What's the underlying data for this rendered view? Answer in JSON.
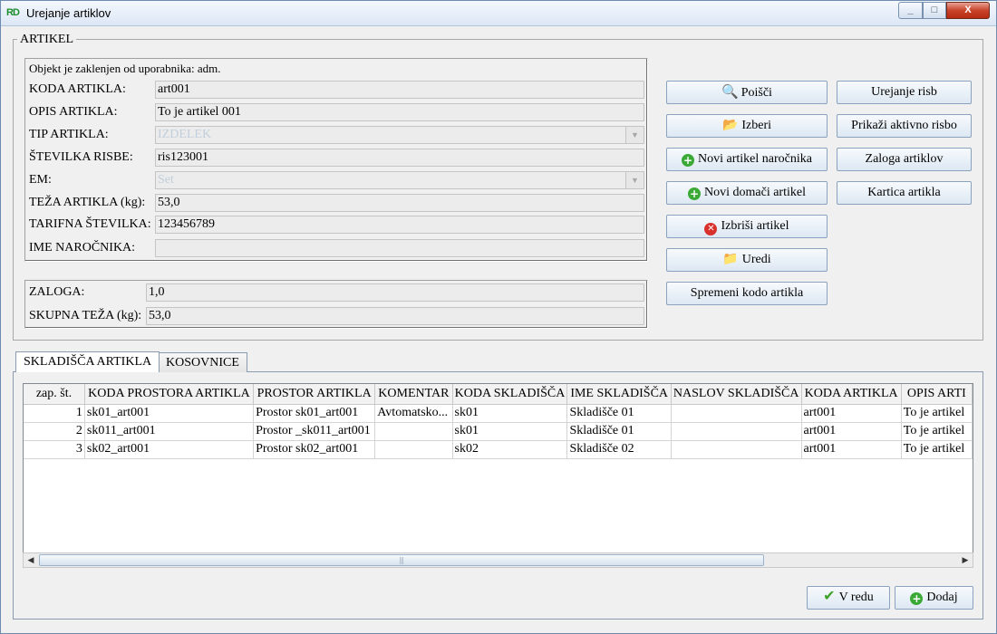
{
  "window": {
    "title": "Urejanje artiklov",
    "icon_text": "RD",
    "controls": {
      "minimize": "_",
      "maximize": "□",
      "close": "X"
    }
  },
  "group": {
    "legend": "ARTIKEL",
    "lock_message": "Objekt je zaklenjen od uporabnika: adm."
  },
  "fields": {
    "koda": {
      "label": "KODA ARTIKLA:",
      "value": "art001"
    },
    "opis": {
      "label": "OPIS ARTIKLA:",
      "value": "To je artikel 001"
    },
    "tip": {
      "label": "TIP ARTIKLA:",
      "value": "IZDELEK"
    },
    "risba": {
      "label": "ŠTEVILKA RISBE:",
      "value": "ris123001"
    },
    "em": {
      "label": "EM:",
      "value": "Set"
    },
    "teza": {
      "label": "TEŽA ARTIKLA (kg):",
      "value": "53,0"
    },
    "tarifna": {
      "label": "TARIFNA ŠTEVILKA:",
      "value": "123456789"
    },
    "narocnik": {
      "label": "IME NAROČNIKA:",
      "value": ""
    },
    "zaloga": {
      "label": "ZALOGA:",
      "value": "1,0"
    },
    "skupna": {
      "label": "SKUPNA TEŽA (kg):",
      "value": "53,0"
    }
  },
  "buttons": {
    "poisci": "Poišči",
    "izberi": "Izberi",
    "novi_narocnik": "Novi artikel naročnika",
    "novi_domaci": "Novi domači artikel",
    "izbrisi": "Izbriši artikel",
    "uredi": "Uredi",
    "spremeni_kodo": "Spremeni kodo artikla",
    "urejanje_risb": "Urejanje risb",
    "prikazi_risbo": "Prikaži aktivno risbo",
    "zaloga_artiklov": "Zaloga artiklov",
    "kartica": "Kartica artikla",
    "v_redu": "V redu",
    "dodaj": "Dodaj"
  },
  "tabs": [
    {
      "label": "SKLADIŠČA ARTIKLA"
    },
    {
      "label": "KOSOVNICE"
    }
  ],
  "table": {
    "columns": [
      "zap. št.",
      "KODA PROSTORA ARTIKLA",
      "PROSTOR ARTIKLA",
      "KOMENTAR",
      "KODA SKLADIŠČA",
      "IME SKLADIŠČA",
      "NASLOV SKLADIŠČA",
      "KODA ARTIKLA",
      "OPIS ARTI"
    ],
    "rows": [
      [
        "1",
        "sk01_art001",
        "Prostor sk01_art001",
        "Avtomatsko...",
        "sk01",
        "Skladišče 01",
        "",
        "art001",
        "To je artikel"
      ],
      [
        "2",
        "sk011_art001",
        "Prostor _sk011_art001",
        "",
        "sk01",
        "Skladišče 01",
        "",
        "art001",
        "To je artikel"
      ],
      [
        "3",
        "sk02_art001",
        "Prostor sk02_art001",
        "",
        "sk02",
        "Skladišče 02",
        "",
        "art001",
        "To je artikel"
      ]
    ]
  },
  "scrollbar": {
    "left_arrow": "◀",
    "right_arrow": "▶",
    "grip": "|||"
  }
}
